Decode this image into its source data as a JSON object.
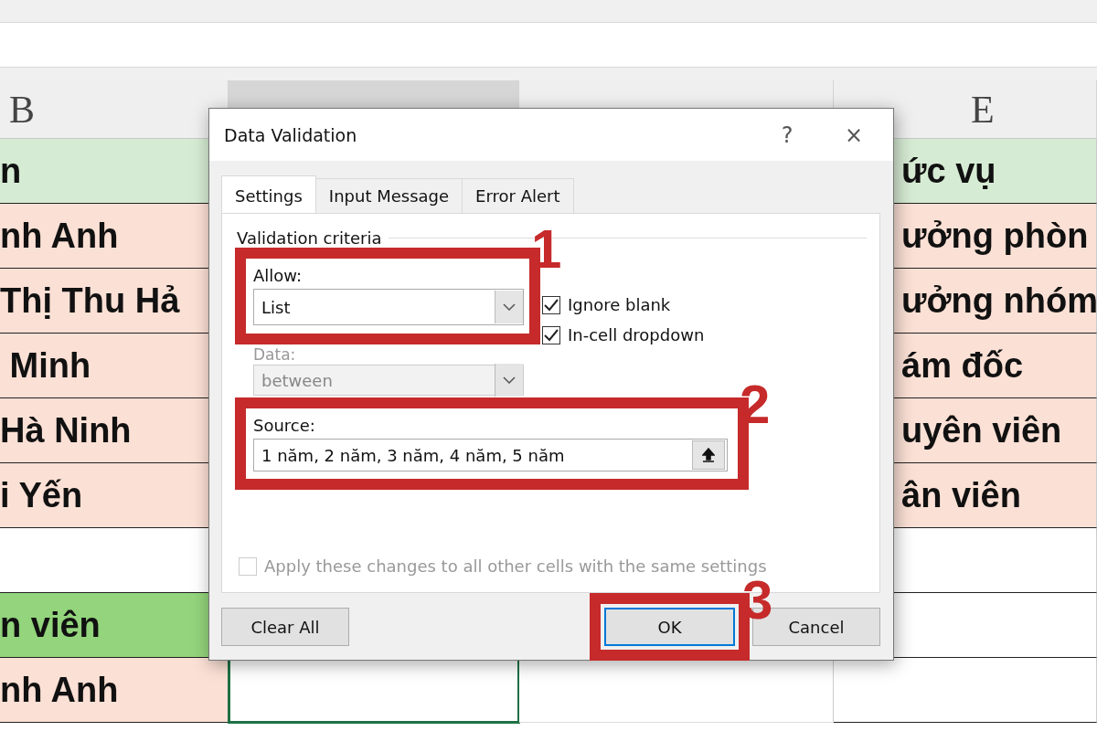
{
  "sheet": {
    "columns": [
      {
        "label": "B",
        "selected": false
      },
      {
        "selected": true
      },
      {
        "selected": false
      },
      {
        "label": "E",
        "selected": false
      }
    ],
    "rows": [
      {
        "kind": "header",
        "b": "n",
        "e": "ức vụ"
      },
      {
        "kind": "data",
        "b": "nh Anh",
        "e": "ưởng phòn"
      },
      {
        "kind": "data",
        "b": "Thị Thu Hả",
        "e": "ưởng nhóm"
      },
      {
        "kind": "data",
        "b": " Minh",
        "e": "ám đốc"
      },
      {
        "kind": "data",
        "b": "Hà Ninh",
        "e": "uyên viên"
      },
      {
        "kind": "data",
        "b": "i Yến",
        "e": "ân viên"
      },
      {
        "kind": "blank"
      },
      {
        "kind": "section",
        "b": "n viên"
      },
      {
        "kind": "data",
        "b": "nh Anh",
        "c_selected": true
      }
    ]
  },
  "dialog": {
    "title": "Data Validation",
    "help_button": "?",
    "close_button": "×",
    "tabs": [
      {
        "label": "Settings",
        "selected": true
      },
      {
        "label": "Input Message",
        "selected": false
      },
      {
        "label": "Error Alert",
        "selected": false
      }
    ],
    "group_label": "Validation criteria",
    "allow": {
      "label": "Allow:",
      "value": "List",
      "step": "1"
    },
    "checkboxes": [
      {
        "label": "Ignore blank",
        "checked": true
      },
      {
        "label": "In-cell dropdown",
        "checked": true
      }
    ],
    "data": {
      "label": "Data:",
      "value": "between",
      "disabled": true
    },
    "source": {
      "label": "Source:",
      "value": "1 năm, 2 năm, 3 năm, 4 năm, 5 năm",
      "step": "2"
    },
    "apply_all": {
      "label": "Apply these changes to all other cells with the same settings",
      "checked": false,
      "disabled": true
    },
    "buttons": [
      {
        "label": "Clear All",
        "default": false
      },
      {
        "label": "OK",
        "default": true,
        "step": "3"
      },
      {
        "label": "Cancel",
        "default": false
      }
    ]
  }
}
